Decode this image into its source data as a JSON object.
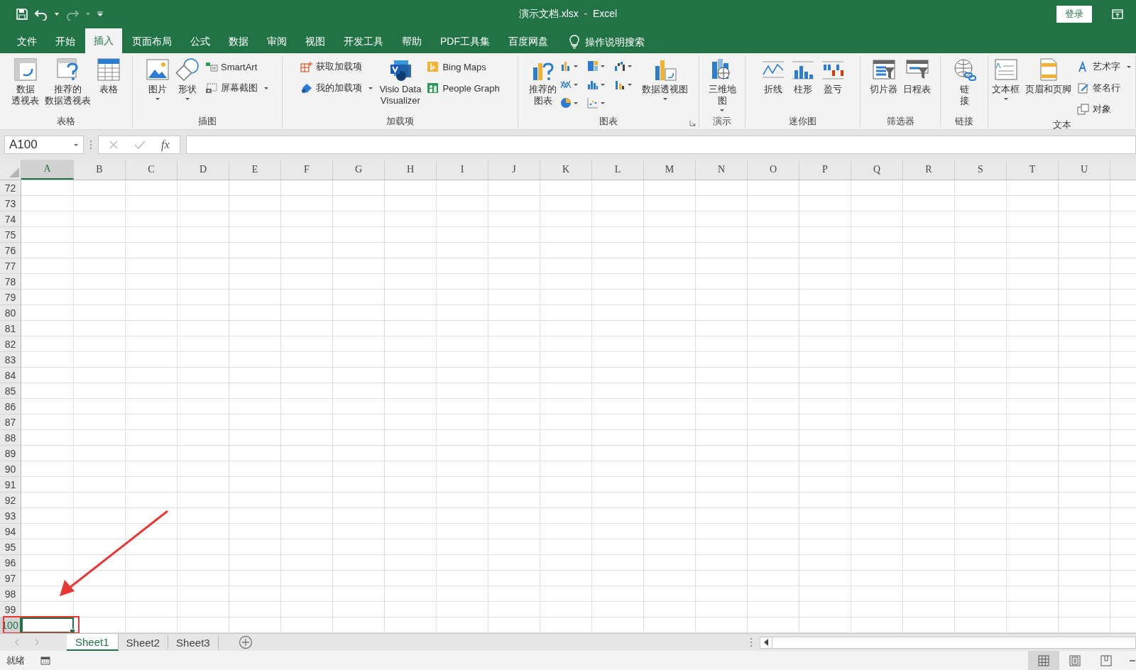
{
  "window": {
    "title": "演示文档.xlsx  -  Excel",
    "sign_in": "登录"
  },
  "menu_tabs": [
    {
      "label": "文件",
      "selected": false
    },
    {
      "label": "开始",
      "selected": false
    },
    {
      "label": "插入",
      "selected": true
    },
    {
      "label": "页面布局",
      "selected": false
    },
    {
      "label": "公式",
      "selected": false
    },
    {
      "label": "数据",
      "selected": false
    },
    {
      "label": "审阅",
      "selected": false
    },
    {
      "label": "视图",
      "selected": false
    },
    {
      "label": "开发工具",
      "selected": false
    },
    {
      "label": "帮助",
      "selected": false
    },
    {
      "label": "PDF工具集",
      "selected": false
    },
    {
      "label": "百度网盘",
      "selected": false
    }
  ],
  "tell_me": {
    "placeholder": "操作说明搜索"
  },
  "ribbon_groups": [
    {
      "label": "表格",
      "items": [
        {
          "kind": "large",
          "lines": [
            "数据",
            "透视表"
          ]
        },
        {
          "kind": "large",
          "lines": [
            "推荐的",
            "数据透视表"
          ]
        },
        {
          "kind": "large",
          "lines": [
            "表格"
          ]
        }
      ]
    },
    {
      "label": "插图",
      "items": [
        {
          "kind": "large",
          "lines": [
            "图片"
          ],
          "dropdown": true
        },
        {
          "kind": "large",
          "lines": [
            "形状"
          ],
          "dropdown": true
        },
        {
          "kind": "stack",
          "entries": [
            {
              "label": "SmartArt",
              "dropdown": false
            },
            {
              "label": "屏幕截图",
              "dropdown": true
            }
          ]
        }
      ]
    },
    {
      "label": "加载项",
      "items": [
        {
          "kind": "stack",
          "entries": [
            {
              "label": "获取加载项",
              "dropdown": false
            },
            {
              "label": "我的加载项",
              "dropdown": true
            }
          ]
        },
        {
          "kind": "large",
          "lines": [
            "Visio Data",
            "Visualizer"
          ]
        },
        {
          "kind": "stack",
          "entries": [
            {
              "label": "Bing Maps",
              "dropdown": false
            },
            {
              "label": "People Graph",
              "dropdown": false
            }
          ]
        }
      ]
    },
    {
      "label": "图表",
      "launcher": true,
      "items": [
        {
          "kind": "large",
          "lines": [
            "推荐的",
            "图表"
          ]
        },
        {
          "kind": "chart-grid"
        },
        {
          "kind": "large",
          "lines": [
            "数据透视图"
          ],
          "dropdown": true
        }
      ]
    },
    {
      "label": "演示",
      "items": [
        {
          "kind": "large",
          "lines": [
            "三维地",
            "图"
          ],
          "dropdown": true
        }
      ]
    },
    {
      "label": "迷你图",
      "items": [
        {
          "kind": "large",
          "lines": [
            "折线"
          ]
        },
        {
          "kind": "large",
          "lines": [
            "柱形"
          ]
        },
        {
          "kind": "large",
          "lines": [
            "盈亏"
          ]
        }
      ]
    },
    {
      "label": "筛选器",
      "items": [
        {
          "kind": "large",
          "lines": [
            "切片器"
          ]
        },
        {
          "kind": "large",
          "lines": [
            "日程表"
          ]
        }
      ]
    },
    {
      "label": "链接",
      "items": [
        {
          "kind": "large",
          "lines": [
            "链",
            "接"
          ]
        }
      ]
    },
    {
      "label": "文本",
      "items": [
        {
          "kind": "large",
          "lines": [
            "文本框"
          ],
          "dropdown": true
        },
        {
          "kind": "large",
          "lines": [
            "页眉和页脚"
          ]
        },
        {
          "kind": "stack",
          "entries": [
            {
              "label": "艺术字",
              "dropdown": true
            },
            {
              "label": "签名行",
              "dropdown": false
            },
            {
              "label": "对象",
              "dropdown": false
            }
          ]
        }
      ]
    }
  ],
  "formula_bar": {
    "name_box": "A100",
    "function_label": "fx"
  },
  "columns": [
    {
      "label": "A",
      "selected": true
    },
    {
      "label": "B",
      "selected": false
    },
    {
      "label": "C",
      "selected": false
    },
    {
      "label": "D",
      "selected": false
    },
    {
      "label": "E",
      "selected": false
    },
    {
      "label": "F",
      "selected": false
    },
    {
      "label": "G",
      "selected": false
    },
    {
      "label": "H",
      "selected": false
    },
    {
      "label": "I",
      "selected": false
    },
    {
      "label": "J",
      "selected": false
    },
    {
      "label": "K",
      "selected": false
    },
    {
      "label": "L",
      "selected": false
    },
    {
      "label": "M",
      "selected": false
    },
    {
      "label": "N",
      "selected": false
    },
    {
      "label": "O",
      "selected": false
    },
    {
      "label": "P",
      "selected": false
    },
    {
      "label": "Q",
      "selected": false
    },
    {
      "label": "R",
      "selected": false
    },
    {
      "label": "S",
      "selected": false
    },
    {
      "label": "T",
      "selected": false
    },
    {
      "label": "U",
      "selected": false
    }
  ],
  "rows": [
    {
      "label": "72",
      "selected": false
    },
    {
      "label": "73",
      "selected": false
    },
    {
      "label": "74",
      "selected": false
    },
    {
      "label": "75",
      "selected": false
    },
    {
      "label": "76",
      "selected": false
    },
    {
      "label": "77",
      "selected": false
    },
    {
      "label": "78",
      "selected": false
    },
    {
      "label": "79",
      "selected": false
    },
    {
      "label": "80",
      "selected": false
    },
    {
      "label": "81",
      "selected": false
    },
    {
      "label": "82",
      "selected": false
    },
    {
      "label": "83",
      "selected": false
    },
    {
      "label": "84",
      "selected": false
    },
    {
      "label": "85",
      "selected": false
    },
    {
      "label": "86",
      "selected": false
    },
    {
      "label": "87",
      "selected": false
    },
    {
      "label": "88",
      "selected": false
    },
    {
      "label": "89",
      "selected": false
    },
    {
      "label": "90",
      "selected": false
    },
    {
      "label": "91",
      "selected": false
    },
    {
      "label": "92",
      "selected": false
    },
    {
      "label": "93",
      "selected": false
    },
    {
      "label": "94",
      "selected": false
    },
    {
      "label": "95",
      "selected": false
    },
    {
      "label": "96",
      "selected": false
    },
    {
      "label": "97",
      "selected": false
    },
    {
      "label": "98",
      "selected": false
    },
    {
      "label": "99",
      "selected": false
    },
    {
      "label": "100",
      "selected": true
    }
  ],
  "sheet_tabs": [
    {
      "label": "Sheet1",
      "selected": true
    },
    {
      "label": "Sheet2",
      "selected": false
    },
    {
      "label": "Sheet3",
      "selected": false
    }
  ],
  "status_bar": {
    "text": "就绪",
    "views": [
      {
        "kind": "normal",
        "selected": true
      },
      {
        "kind": "page-layout",
        "selected": false
      },
      {
        "kind": "page-break",
        "selected": false
      }
    ]
  }
}
